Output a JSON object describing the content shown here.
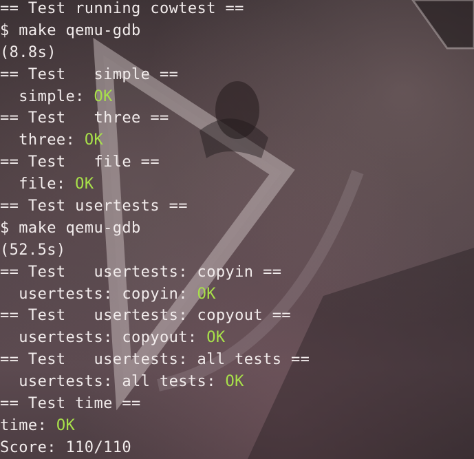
{
  "terminal": {
    "lines": [
      {
        "text": "== Test running cowtest ==",
        "status": ""
      },
      {
        "text": "$ make qemu-gdb",
        "status": ""
      },
      {
        "text": "(8.8s)",
        "status": ""
      },
      {
        "text": "== Test   simple ==",
        "status": ""
      },
      {
        "text": "  simple: ",
        "status": "OK"
      },
      {
        "text": "== Test   three ==",
        "status": ""
      },
      {
        "text": "  three: ",
        "status": "OK"
      },
      {
        "text": "== Test   file ==",
        "status": ""
      },
      {
        "text": "  file: ",
        "status": "OK"
      },
      {
        "text": "== Test usertests ==",
        "status": ""
      },
      {
        "text": "$ make qemu-gdb",
        "status": ""
      },
      {
        "text": "(52.5s)",
        "status": ""
      },
      {
        "text": "== Test   usertests: copyin ==",
        "status": ""
      },
      {
        "text": "  usertests: copyin: ",
        "status": "OK"
      },
      {
        "text": "== Test   usertests: copyout ==",
        "status": ""
      },
      {
        "text": "  usertests: copyout: ",
        "status": "OK"
      },
      {
        "text": "== Test   usertests: all tests ==",
        "status": ""
      },
      {
        "text": "  usertests: all tests: ",
        "status": "OK"
      },
      {
        "text": "== Test time ==",
        "status": ""
      },
      {
        "text": "time: ",
        "status": "OK"
      },
      {
        "text": "Score: 110/110",
        "status": ""
      }
    ]
  },
  "colors": {
    "text": "#f2ecec",
    "ok": "#a8e14a",
    "background": "#4a3d40"
  }
}
